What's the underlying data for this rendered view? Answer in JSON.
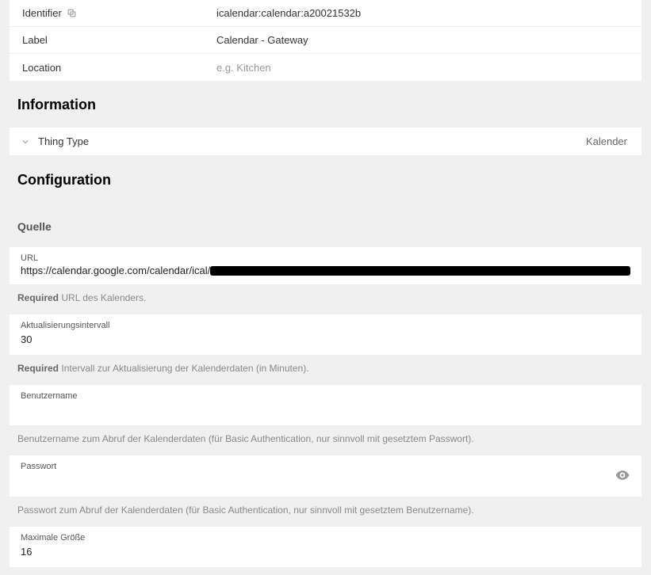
{
  "top": {
    "identifier_label": "Identifier",
    "identifier_value": "icalendar:calendar:a20021532b",
    "label_label": "Label",
    "label_value": "Calendar - Gateway",
    "location_label": "Location",
    "location_placeholder": "e.g. Kitchen"
  },
  "sections": {
    "information_title": "Information",
    "thing_type_label": "Thing Type",
    "thing_type_value": "Kalender",
    "configuration_title": "Configuration"
  },
  "group": {
    "quelle_title": "Quelle"
  },
  "fields": {
    "url": {
      "label": "URL",
      "value_visible": "https://calendar.google.com/calendar/ical/",
      "hint_required": "Required",
      "hint_text": "URL des Kalenders."
    },
    "interval": {
      "label": "Aktualisierungsintervall",
      "value": "30",
      "hint_required": "Required",
      "hint_text": "Intervall zur Aktualisierung der Kalenderdaten (in Minuten)."
    },
    "username": {
      "label": "Benutzername",
      "value": "",
      "hint_text": "Benutzername zum Abruf der Kalenderdaten (für Basic Authentication, nur sinnvoll mit gesetztem Passwort)."
    },
    "password": {
      "label": "Passwort",
      "value": "",
      "hint_text": "Passwort zum Abruf der Kalenderdaten (für Basic Authentication, nur sinnvoll mit gesetztem Benutzername)."
    },
    "maxsize": {
      "label": "Maximale Größe",
      "value": "16"
    }
  }
}
